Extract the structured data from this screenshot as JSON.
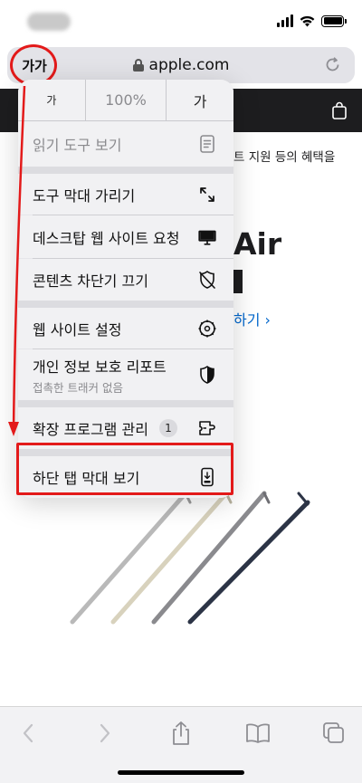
{
  "status_bar": {
    "time": ""
  },
  "address_bar": {
    "aa_label": "가가",
    "domain": "apple.com"
  },
  "page": {
    "banner_text": "트 지원 등의 혜택을",
    "hero_title": "Air",
    "hero_link": "하기 ›"
  },
  "menu": {
    "zoom": {
      "decrease_label": "가",
      "level": "100%",
      "increase_label": "가"
    },
    "reader_view": {
      "label": "읽기 도구 보기",
      "icon": "reader-icon"
    },
    "hide_toolbar": {
      "label": "도구 막대 가리기",
      "icon": "expand-arrows-icon"
    },
    "desktop_site": {
      "label": "데스크탑 웹 사이트 요청",
      "icon": "monitor-icon"
    },
    "content_blockers": {
      "label": "콘텐츠 차단기 끄기",
      "icon": "shield-off-icon"
    },
    "website_settings": {
      "label": "웹 사이트 설정",
      "icon": "gear-icon"
    },
    "privacy_report": {
      "label": "개인 정보 보호 리포트",
      "sublabel": "접촉한 트래커 없음",
      "icon": "privacy-shield-icon"
    },
    "extensions": {
      "label": "확장 프로그램 관리",
      "count": "1",
      "icon": "extension-icon"
    },
    "bottom_tab_bar": {
      "label": "하단 탭 막대 보기",
      "icon": "phone-bottom-bar-icon"
    }
  },
  "toolbar": {
    "back_icon": "chevron-left-icon",
    "forward_icon": "chevron-right-icon",
    "share_icon": "share-icon",
    "bookmarks_icon": "book-icon",
    "tabs_icon": "tabs-icon"
  },
  "annotation_color": "#e31a1a"
}
